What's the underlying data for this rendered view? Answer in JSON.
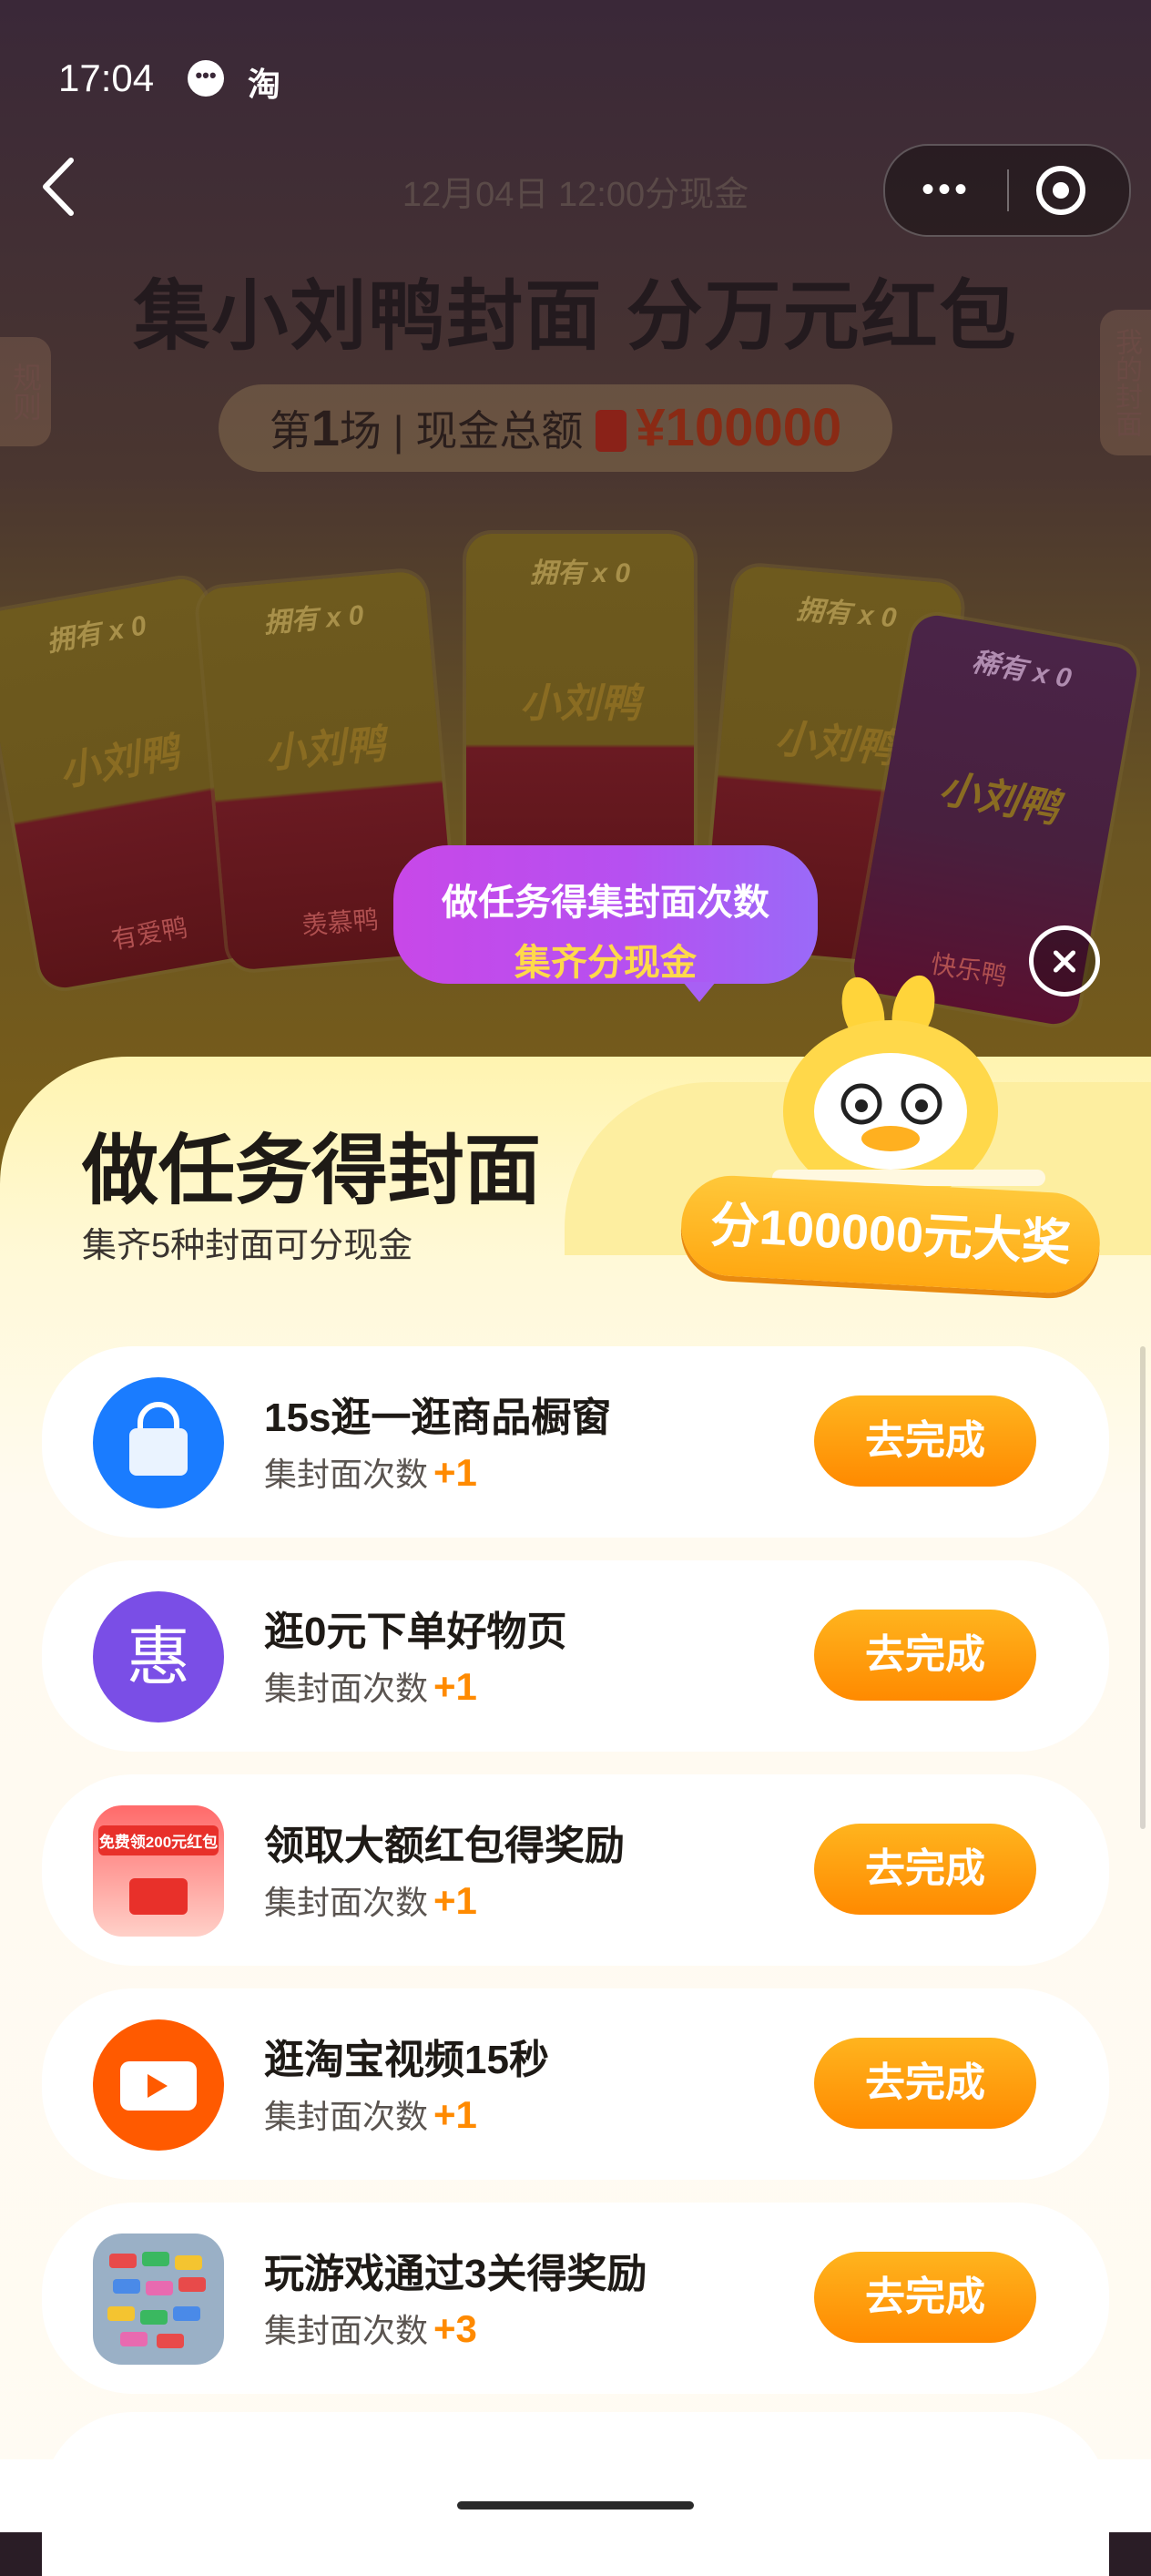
{
  "status_bar": {
    "time": "17:04",
    "chat_icon": "chat-bubble-icon",
    "app_icon_text": "淘"
  },
  "nav": {
    "back_icon": "chevron-left-icon",
    "more_icon": "more-dots-icon",
    "close_miniapp_icon": "target-icon"
  },
  "event": {
    "date": "12月04日 12:00分现金",
    "title": "集小刘鸭封面 分万元红包",
    "round_prefix": "第",
    "round_number": "1",
    "round_suffix": "场 | 现金总额",
    "total_amount": "¥100000",
    "rules_tab": "规则",
    "my_covers_tab": "我的封面"
  },
  "cover_cards": [
    {
      "own_label": "拥有 x 0",
      "name": "有爱鸭",
      "logo": "小刘鸭"
    },
    {
      "own_label": "拥有 x 0",
      "name": "羡慕鸭",
      "logo": "小刘鸭"
    },
    {
      "own_label": "拥有 x 0",
      "name": "",
      "logo": "小刘鸭"
    },
    {
      "own_label": "拥有 x 0",
      "name": "",
      "logo": "小刘鸭"
    },
    {
      "own_label": "稀有 x 0",
      "name": "快乐鸭",
      "logo": "小刘鸭"
    }
  ],
  "bubble": {
    "line1": "做任务得集封面次数",
    "line2": "集齐分现金"
  },
  "sheet": {
    "title": "做任务得封面",
    "subtitle": "集齐5种封面可分现金",
    "prize_badge": "分100000元大奖"
  },
  "tasks": [
    {
      "title": "15s逛一逛商品橱窗",
      "meta": "集封面次数",
      "plus": "+1",
      "button": "去完成",
      "icon": "shopping-bag-icon"
    },
    {
      "title": "逛0元下单好物页",
      "meta": "集封面次数",
      "plus": "+1",
      "button": "去完成",
      "icon": "hui-discount-icon",
      "icon_text": "惠"
    },
    {
      "title": "领取大额红包得奖励",
      "meta": "集封面次数",
      "plus": "+1",
      "button": "去完成",
      "icon": "red-packet-promo-icon",
      "icon_text": "免费领200元红包"
    },
    {
      "title": "逛淘宝视频15秒",
      "meta": "集封面次数",
      "plus": "+1",
      "button": "去完成",
      "icon": "video-camera-icon"
    },
    {
      "title": "玩游戏通过3关得奖励",
      "meta": "集封面次数",
      "plus": "+3",
      "button": "去完成",
      "icon": "puzzle-game-icon"
    }
  ],
  "colors": {
    "accent_orange": "#ff8a00",
    "bubble_purple": "#b650f0",
    "sheet_yellow": "#fff4b0"
  }
}
